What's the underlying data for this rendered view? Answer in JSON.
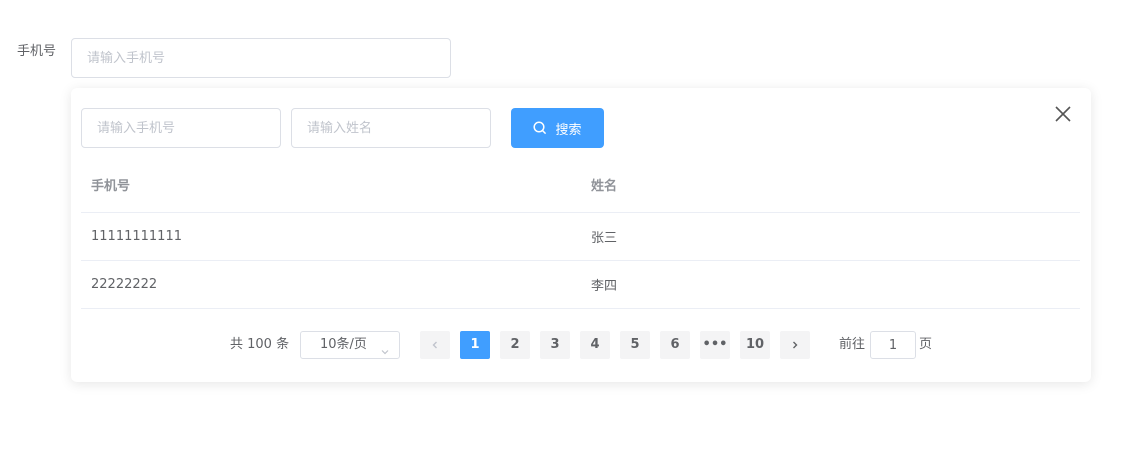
{
  "form": {
    "label": "手机号",
    "placeholder": "请输入手机号"
  },
  "popover": {
    "search": {
      "phone_placeholder": "请输入手机号",
      "name_placeholder": "请输入姓名",
      "button_label": "搜索",
      "button_color": "#409eff"
    },
    "table": {
      "columns": [
        "手机号",
        "姓名"
      ],
      "rows": [
        [
          "11111111111",
          "张三"
        ],
        [
          "22222222",
          "李四"
        ]
      ]
    },
    "pagination": {
      "total_text": "共 100 条",
      "page_size": "10条/页",
      "pages": [
        "1",
        "2",
        "3",
        "4",
        "5",
        "6",
        "•••",
        "10"
      ],
      "current_page": "1",
      "goto_prefix": "前往",
      "goto_value": "1",
      "goto_suffix": "页"
    }
  },
  "icons": {
    "close": "close-icon",
    "search": "search-icon",
    "prev": "chevron-left-icon",
    "next": "chevron-right-icon",
    "select_arrow": "chevron-down-icon"
  }
}
